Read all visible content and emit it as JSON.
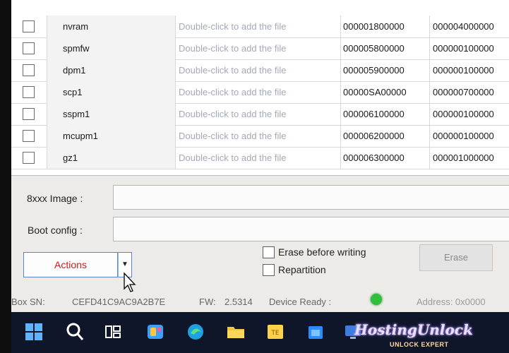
{
  "table": {
    "rows": [
      {
        "name": "nvram",
        "location": "Double-click to add the file",
        "begin": "000001800000",
        "end": "000004000000"
      },
      {
        "name": "spmfw",
        "location": "Double-click to add the file",
        "begin": "000005800000",
        "end": "000000100000"
      },
      {
        "name": "dpm1",
        "location": "Double-click to add the file",
        "begin": "000005900000",
        "end": "000000100000"
      },
      {
        "name": "scp1",
        "location": "Double-click to add the file",
        "begin": "00000SA00000",
        "end": "000000700000"
      },
      {
        "name": "sspm1",
        "location": "Double-click to add the file",
        "begin": "000006100000",
        "end": "000000100000"
      },
      {
        "name": "mcupm1",
        "location": "Double-click to add the file",
        "begin": "000006200000",
        "end": "000000100000"
      },
      {
        "name": "gz1",
        "location": "Double-click to add the file",
        "begin": "000006300000",
        "end": "000001000000"
      }
    ]
  },
  "form": {
    "image_label": "8xxx Image :",
    "image_value": "",
    "boot_label": "Boot config :",
    "boot_value": ""
  },
  "controls": {
    "actions_label": "Actions",
    "actions_arrow": "▼",
    "erase_before_writing": "Erase before writing",
    "repartition": "Repartition",
    "erase_label": "Erase"
  },
  "status": {
    "box_sn_label": "Box SN:",
    "box_sn": "CEFD41C9AC9A2B7E",
    "fw_label": "FW:",
    "fw": "2.5314",
    "device_status": "Device Ready :",
    "address_label": "Address: 0x0000"
  },
  "watermark": {
    "brand": "HostingUnlock",
    "tagline": "UNLOCK EXPERT"
  },
  "colors": {
    "accent_red": "#d21a1a",
    "ready_green": "#2fbf3a",
    "taskbar": "#10162a"
  }
}
